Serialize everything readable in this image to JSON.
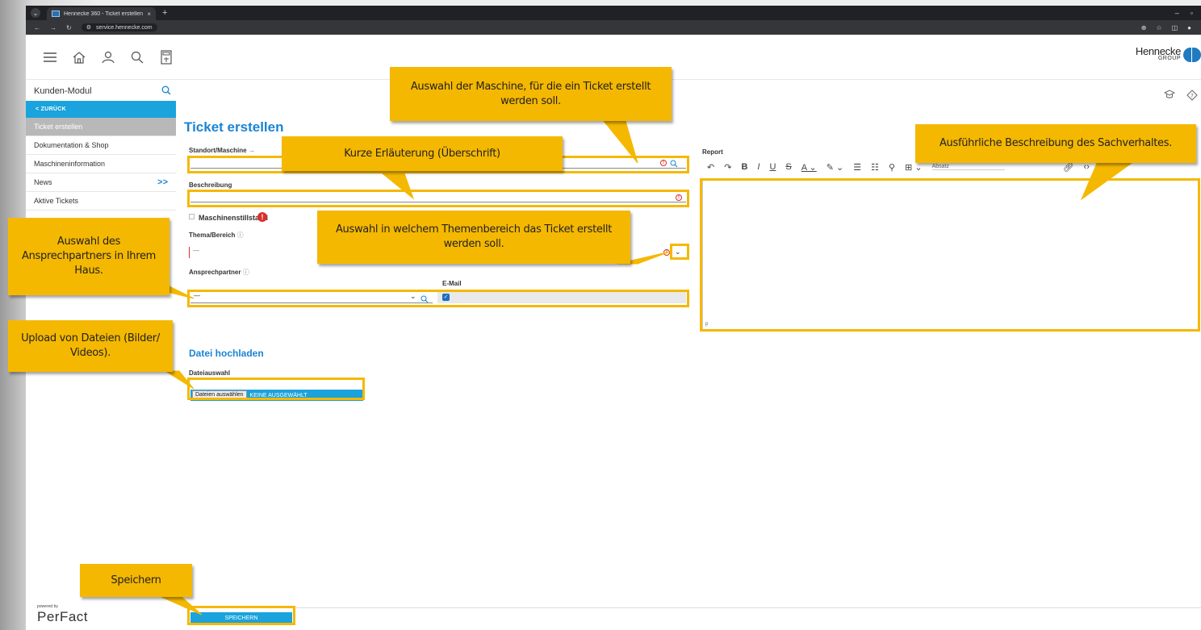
{
  "browser": {
    "tab_title": "Hennecke 360 - Ticket erstellen",
    "tab_close": "×",
    "new_tab": "+",
    "url": "service.hennecke.com",
    "window_minimize": "–",
    "window_maximize": "▫"
  },
  "brand": {
    "name": "Hennecke",
    "sub": "GROUP"
  },
  "sidebar": {
    "module_title": "Kunden-Modul",
    "back_label": "< ZURÜCK",
    "items": [
      {
        "label": "Ticket erstellen",
        "active": true
      },
      {
        "label": "Dokumentation & Shop"
      },
      {
        "label": "Maschineninformation"
      },
      {
        "label": "News",
        "more": ">>"
      },
      {
        "label": "Aktive Tickets"
      }
    ],
    "powered_by": "powered by",
    "powered_name": "PerFact"
  },
  "main": {
    "title": "Ticket erstellen",
    "standort_label": "Standort/Maschine",
    "beschreibung_label": "Beschreibung",
    "stillstand_label": "Maschinenstillstand",
    "thema_label": "Thema/Bereich",
    "thema_value": "—",
    "ansprech_label": "Ansprechpartner",
    "ansprech_value": "—",
    "email_label": "E-Mail",
    "report_label": "Report",
    "absatz_label": "Absatz",
    "editor_status": "p",
    "upload_section_title": "Datei hochladen",
    "upload_label": "Dateiauswahl",
    "upload_button": "Dateien auswählen",
    "upload_none": "KEINE AUSGEWÄHLT",
    "save_button": "SPEICHERN"
  },
  "callouts": {
    "maschine": "Auswahl der Maschine, für die ein Ticket erstellt werden soll.",
    "kurz": "Kurze Erläuterung (Überschrift)",
    "report": "Ausführliche Beschreibung des Sachverhaltes.",
    "thema": "Auswahl in welchem Themenbereich das Ticket erstellt werden soll.",
    "ansprech": "Auswahl des Ansprechpartners in Ihrem Haus.",
    "upload": "Upload von Dateien (Bilder/ Videos).",
    "speichern": "Speichern"
  },
  "colors": {
    "accent": "#1aa3dc",
    "highlight": "#f5b800",
    "title": "#1a84d4"
  }
}
